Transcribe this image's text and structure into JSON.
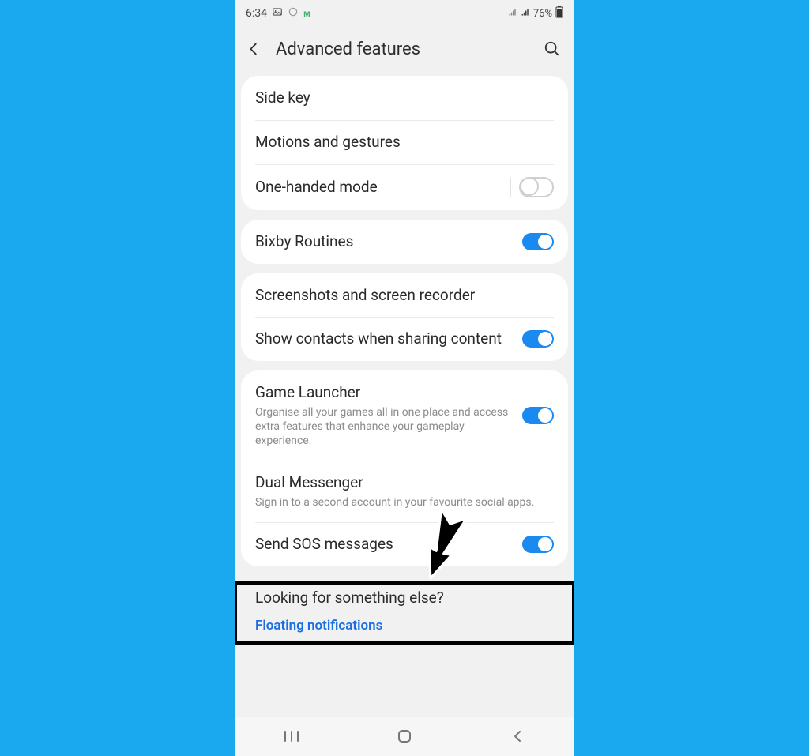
{
  "statusbar": {
    "time": "6:34",
    "battery_text": "76%"
  },
  "header": {
    "title": "Advanced features"
  },
  "groups": {
    "g1_side_key": "Side key",
    "g1_motions": "Motions and gestures",
    "g1_one_handed": "One-handed mode",
    "g2_bixby": "Bixby Routines",
    "g3_screenshots": "Screenshots and screen recorder",
    "g3_contacts": "Show contacts when sharing content",
    "g4_game_launcher_title": "Game Launcher",
    "g4_game_launcher_sub": "Organise all your games all in one place and access extra features that enhance your gameplay experience.",
    "g4_dual_title": "Dual Messenger",
    "g4_dual_sub": "Sign in to a second account in your favourite social apps.",
    "g4_sos": "Send SOS messages"
  },
  "misc": {
    "title": "Looking for something else?",
    "link1": "Floating notifications"
  }
}
